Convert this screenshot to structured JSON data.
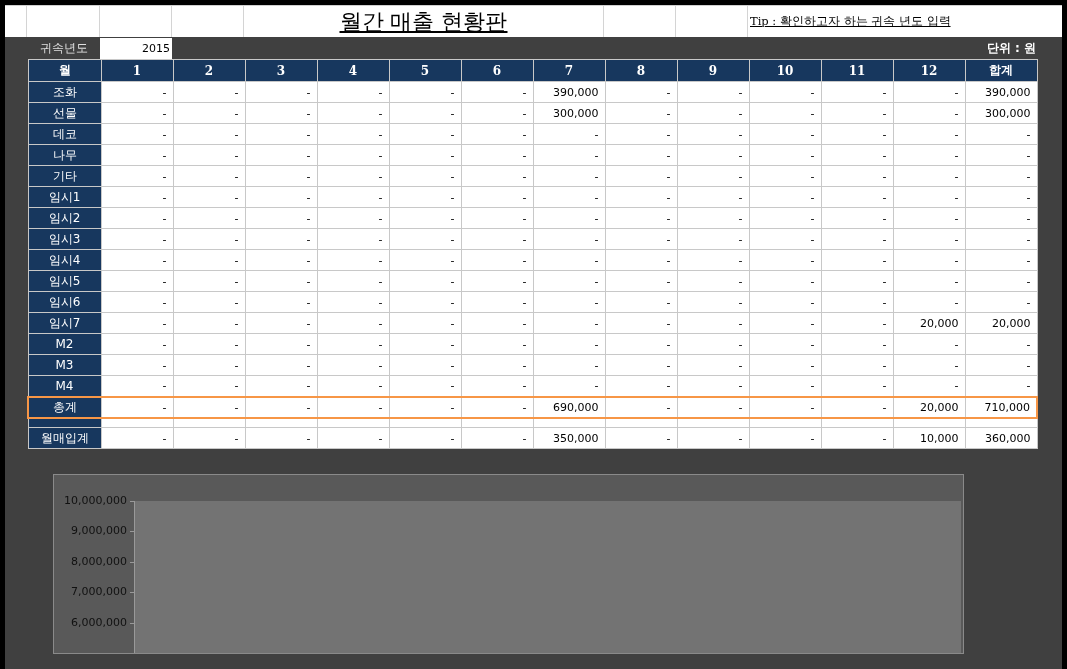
{
  "title": "월간 매출 현황판",
  "tip": "Tip : 확인하고자 하는 귀속 년도 입력",
  "year_label": "귀속년도",
  "year_value": "2015",
  "unit": "단위 : 원",
  "table": {
    "columns": [
      "월",
      "1",
      "2",
      "3",
      "4",
      "5",
      "6",
      "7",
      "8",
      "9",
      "10",
      "11",
      "12",
      "합계"
    ],
    "rows": [
      {
        "label": "조화",
        "highlighted": false,
        "values": [
          "-",
          "-",
          "-",
          "-",
          "-",
          "-",
          "390,000",
          "-",
          "-",
          "-",
          "-",
          "-",
          "390,000"
        ]
      },
      {
        "label": "선물",
        "highlighted": false,
        "values": [
          "-",
          "-",
          "-",
          "-",
          "-",
          "-",
          "300,000",
          "-",
          "-",
          "-",
          "-",
          "-",
          "300,000"
        ]
      },
      {
        "label": "데코",
        "highlighted": false,
        "values": [
          "-",
          "-",
          "-",
          "-",
          "-",
          "-",
          "-",
          "-",
          "-",
          "-",
          "-",
          "-",
          "-"
        ]
      },
      {
        "label": "나무",
        "highlighted": false,
        "values": [
          "-",
          "-",
          "-",
          "-",
          "-",
          "-",
          "-",
          "-",
          "-",
          "-",
          "-",
          "-",
          "-"
        ]
      },
      {
        "label": "기타",
        "highlighted": false,
        "values": [
          "-",
          "-",
          "-",
          "-",
          "-",
          "-",
          "-",
          "-",
          "-",
          "-",
          "-",
          "-",
          "-"
        ]
      },
      {
        "label": "임시1",
        "highlighted": false,
        "values": [
          "-",
          "-",
          "-",
          "-",
          "-",
          "-",
          "-",
          "-",
          "-",
          "-",
          "-",
          "-",
          "-"
        ]
      },
      {
        "label": "임시2",
        "highlighted": false,
        "values": [
          "-",
          "-",
          "-",
          "-",
          "-",
          "-",
          "-",
          "-",
          "-",
          "-",
          "-",
          "-",
          "-"
        ]
      },
      {
        "label": "임시3",
        "highlighted": false,
        "values": [
          "-",
          "-",
          "-",
          "-",
          "-",
          "-",
          "-",
          "-",
          "-",
          "-",
          "-",
          "-",
          "-"
        ]
      },
      {
        "label": "임시4",
        "highlighted": false,
        "values": [
          "-",
          "-",
          "-",
          "-",
          "-",
          "-",
          "-",
          "-",
          "-",
          "-",
          "-",
          "-",
          "-"
        ]
      },
      {
        "label": "임시5",
        "highlighted": false,
        "values": [
          "-",
          "-",
          "-",
          "-",
          "-",
          "-",
          "-",
          "-",
          "-",
          "-",
          "-",
          "-",
          "-"
        ]
      },
      {
        "label": "임시6",
        "highlighted": false,
        "values": [
          "-",
          "-",
          "-",
          "-",
          "-",
          "-",
          "-",
          "-",
          "-",
          "-",
          "-",
          "-",
          "-"
        ]
      },
      {
        "label": "임시7",
        "highlighted": false,
        "values": [
          "-",
          "-",
          "-",
          "-",
          "-",
          "-",
          "-",
          "-",
          "-",
          "-",
          "-",
          "20,000",
          "20,000"
        ]
      },
      {
        "label": "M2",
        "highlighted": false,
        "values": [
          "-",
          "-",
          "-",
          "-",
          "-",
          "-",
          "-",
          "-",
          "-",
          "-",
          "-",
          "-",
          "-"
        ]
      },
      {
        "label": "M3",
        "highlighted": false,
        "values": [
          "-",
          "-",
          "-",
          "-",
          "-",
          "-",
          "-",
          "-",
          "-",
          "-",
          "-",
          "-",
          "-"
        ]
      },
      {
        "label": "M4",
        "highlighted": false,
        "values": [
          "-",
          "-",
          "-",
          "-",
          "-",
          "-",
          "-",
          "-",
          "-",
          "-",
          "-",
          "-",
          "-"
        ]
      },
      {
        "label": "총계",
        "highlighted": true,
        "values": [
          "-",
          "-",
          "-",
          "-",
          "-",
          "-",
          "690,000",
          "-",
          "-",
          "-",
          "-",
          "20,000",
          "710,000"
        ]
      }
    ],
    "summary_row": {
      "label": "월매입계",
      "values": [
        "-",
        "-",
        "-",
        "-",
        "-",
        "-",
        "350,000",
        "-",
        "-",
        "-",
        "-",
        "10,000",
        "360,000"
      ]
    }
  },
  "chart": {
    "y_axis_labels": [
      "10,000,000",
      "9,000,000",
      "8,000,000",
      "7,000,000",
      "6,000,000"
    ]
  }
}
